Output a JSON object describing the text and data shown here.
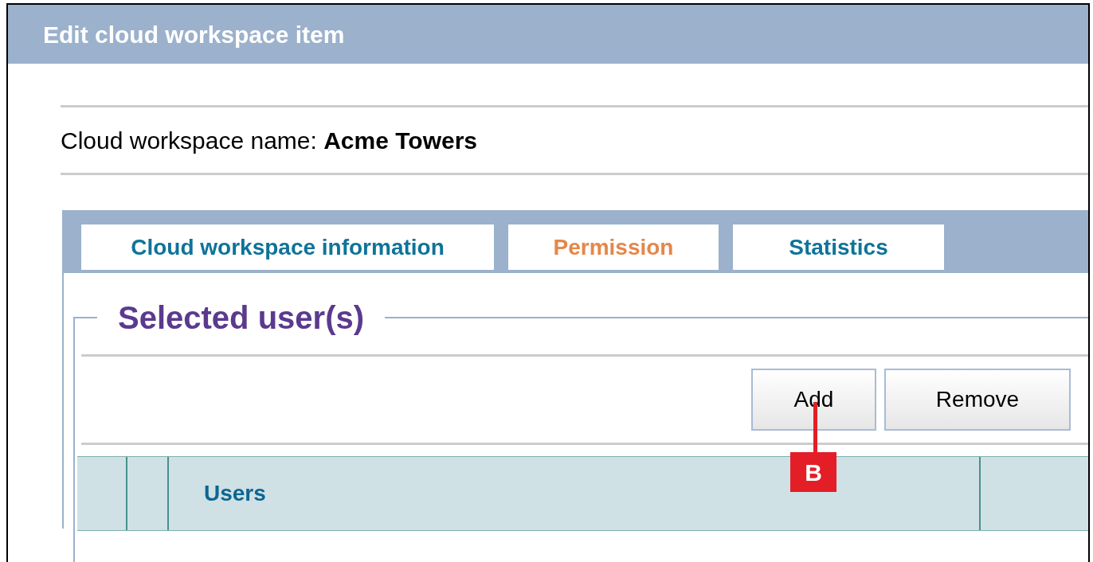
{
  "window": {
    "title": "Edit cloud workspace item"
  },
  "workspace_name": "Cloud workspace name: **Acme Towers**",
  "tabs": [
    {
      "label": "Cloud workspace information",
      "selected": false
    },
    {
      "label": "Permission",
      "selected": true
    },
    {
      "label": "Statistics",
      "selected": false
    }
  ],
  "section": {
    "legend": "Selected user(s)"
  },
  "buttons": [
    "Add",
    "Remove"
  ],
  "table": {
    "columns": [
      "Users"
    ]
  },
  "callout": {
    "label": "B"
  }
}
